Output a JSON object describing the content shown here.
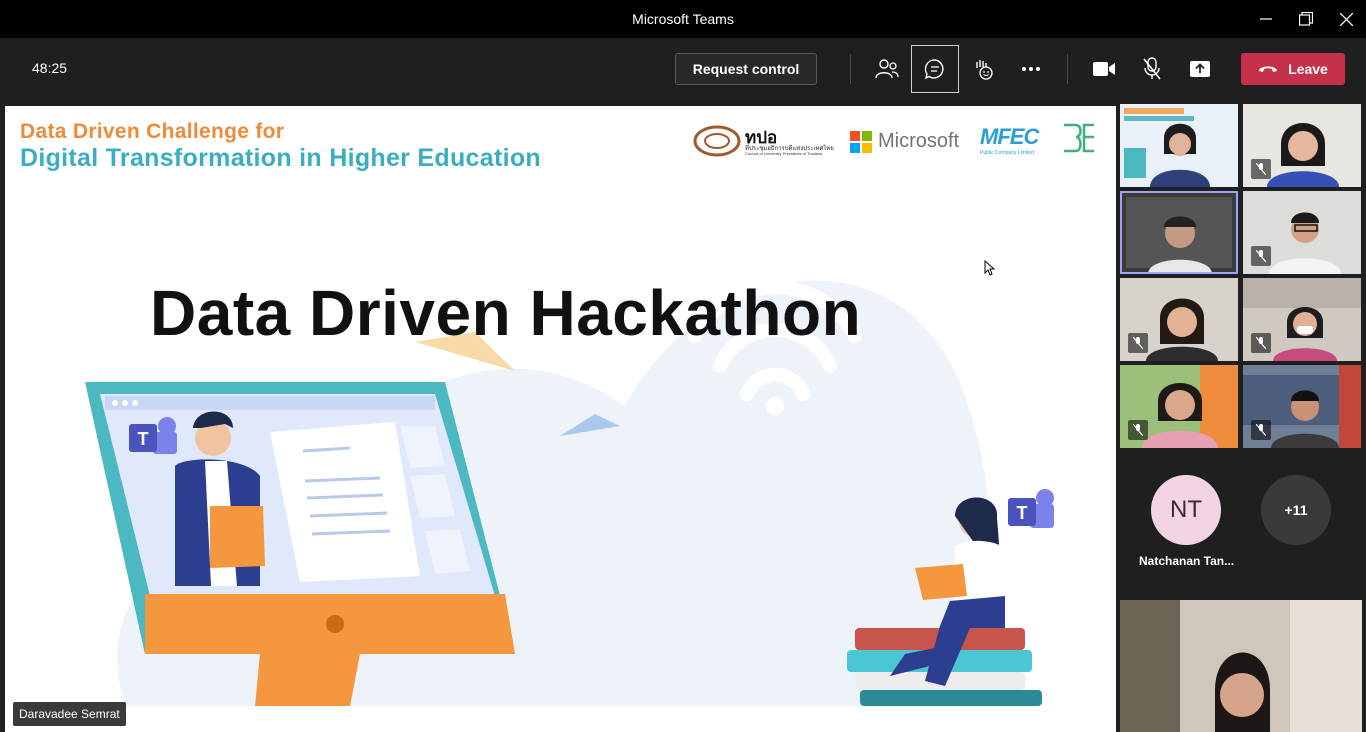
{
  "window": {
    "title": "Microsoft Teams"
  },
  "toolbar": {
    "timer": "48:25",
    "request_control_label": "Request control",
    "leave_label": "Leave",
    "icons": [
      "participants-icon",
      "chat-icon",
      "reactions-icon",
      "more-icon",
      "camera-icon",
      "mic-off-icon",
      "share-icon"
    ]
  },
  "slide": {
    "title_line1": "Data Driven Challenge for",
    "title_line2": "Digital Transformation in Higher Education",
    "heading": "Data Driven Hackathon",
    "logos": {
      "cupt_name": "ทปอ",
      "cupt_sub_thai": "ที่ประชุมอธิการบดีแห่งประเทศไทย",
      "cupt_sub_en": "Council of University Presidents of Thailand",
      "microsoft": "Microsoft",
      "mfec": "MFEC",
      "mfec_sub": "Public Company Limited"
    }
  },
  "presenter": {
    "name": "Daravadee Semrat"
  },
  "participants": {
    "avatar_initials": "NT",
    "avatar_name": "Natchanan Tan...",
    "overflow": "+11"
  },
  "colors": {
    "leave": "#c4314b",
    "active_outline": "#9ea2ff",
    "accent_orange": "#ef8a3a",
    "accent_teal": "#3aaec0"
  }
}
